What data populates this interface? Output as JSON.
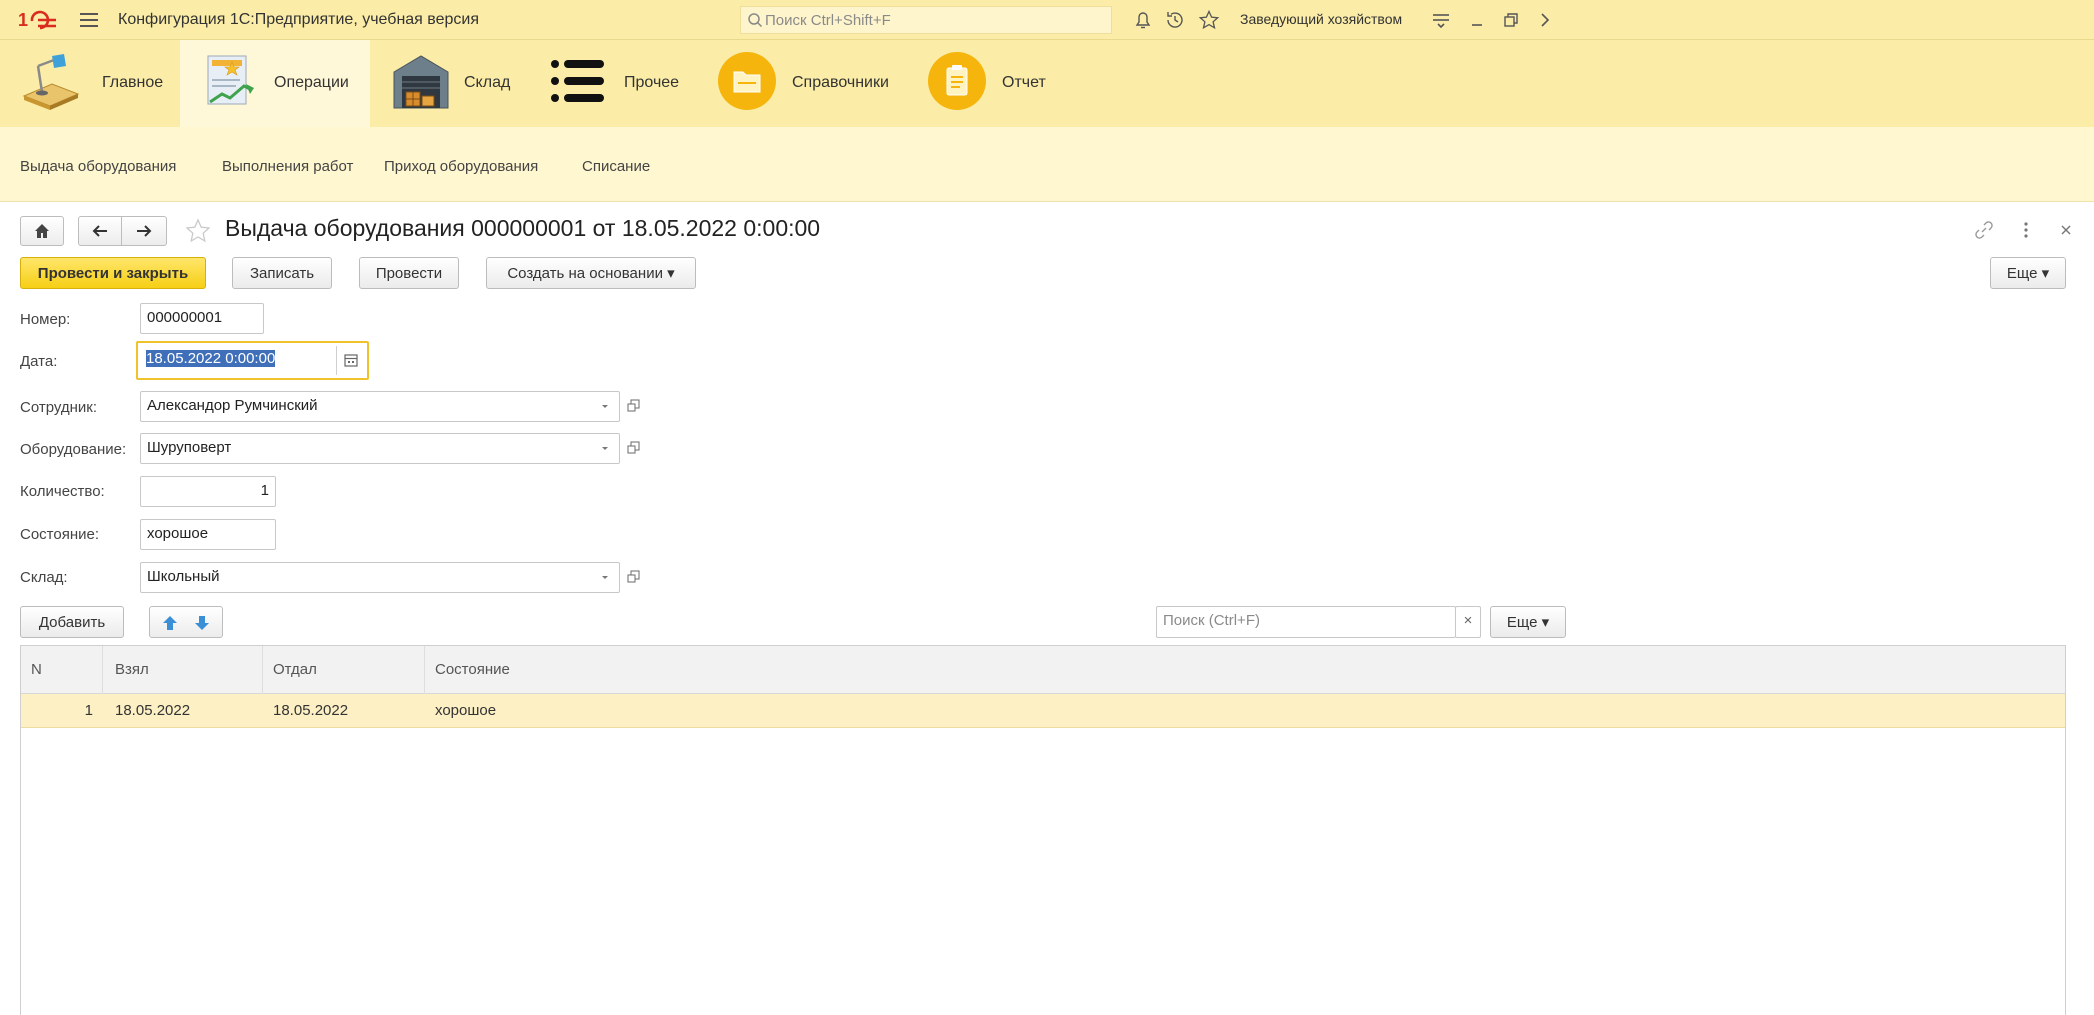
{
  "titlebar": {
    "app_title": "Конфигурация 1С:Предприятие, учебная версия",
    "search_placeholder": "Поиск Ctrl+Shift+F",
    "user": "Заведующий хозяйством"
  },
  "sections": [
    {
      "label": "Главное"
    },
    {
      "label": "Операции"
    },
    {
      "label": "Склад"
    },
    {
      "label": "Прочее"
    },
    {
      "label": "Справочники"
    },
    {
      "label": "Отчет"
    }
  ],
  "nav_links": [
    "Выдача оборудования",
    "Выполнения работ",
    "Приход оборудования",
    "Списание"
  ],
  "form": {
    "title": "Выдача оборудования 000000001 от 18.05.2022 0:00:00",
    "buttons": {
      "post_close": "Провести и закрыть",
      "save": "Записать",
      "post": "Провести",
      "create_based": "Создать на основании ▾",
      "more": "Еще ▾"
    },
    "fields": {
      "number_label": "Номер:",
      "number_value": "000000001",
      "date_label": "Дата:",
      "date_value": "18.05.2022  0:00:00",
      "employee_label": "Сотрудник:",
      "employee_value": "Александор Румчинский",
      "equipment_label": "Оборудование:",
      "equipment_value": "Шуруповерт",
      "quantity_label": "Количество:",
      "quantity_value": "1",
      "state_label": "Состояние:",
      "state_value": "хорошое",
      "warehouse_label": "Склад:",
      "warehouse_value": "Школьный"
    }
  },
  "table_toolbar": {
    "add": "Добавить",
    "search_placeholder": "Поиск (Ctrl+F)",
    "clear": "×",
    "more": "Еще ▾"
  },
  "table": {
    "columns": [
      "N",
      "Взял",
      "Отдал",
      "Состояние"
    ],
    "rows": [
      {
        "n": "1",
        "took": "18.05.2022",
        "returned": "18.05.2022",
        "state": "хорошое"
      }
    ]
  },
  "colors": {
    "panel": "#fbeda7",
    "accent": "#f6cf15",
    "selection": "#3f6fb9",
    "row_highlight": "#fcf0c4"
  }
}
